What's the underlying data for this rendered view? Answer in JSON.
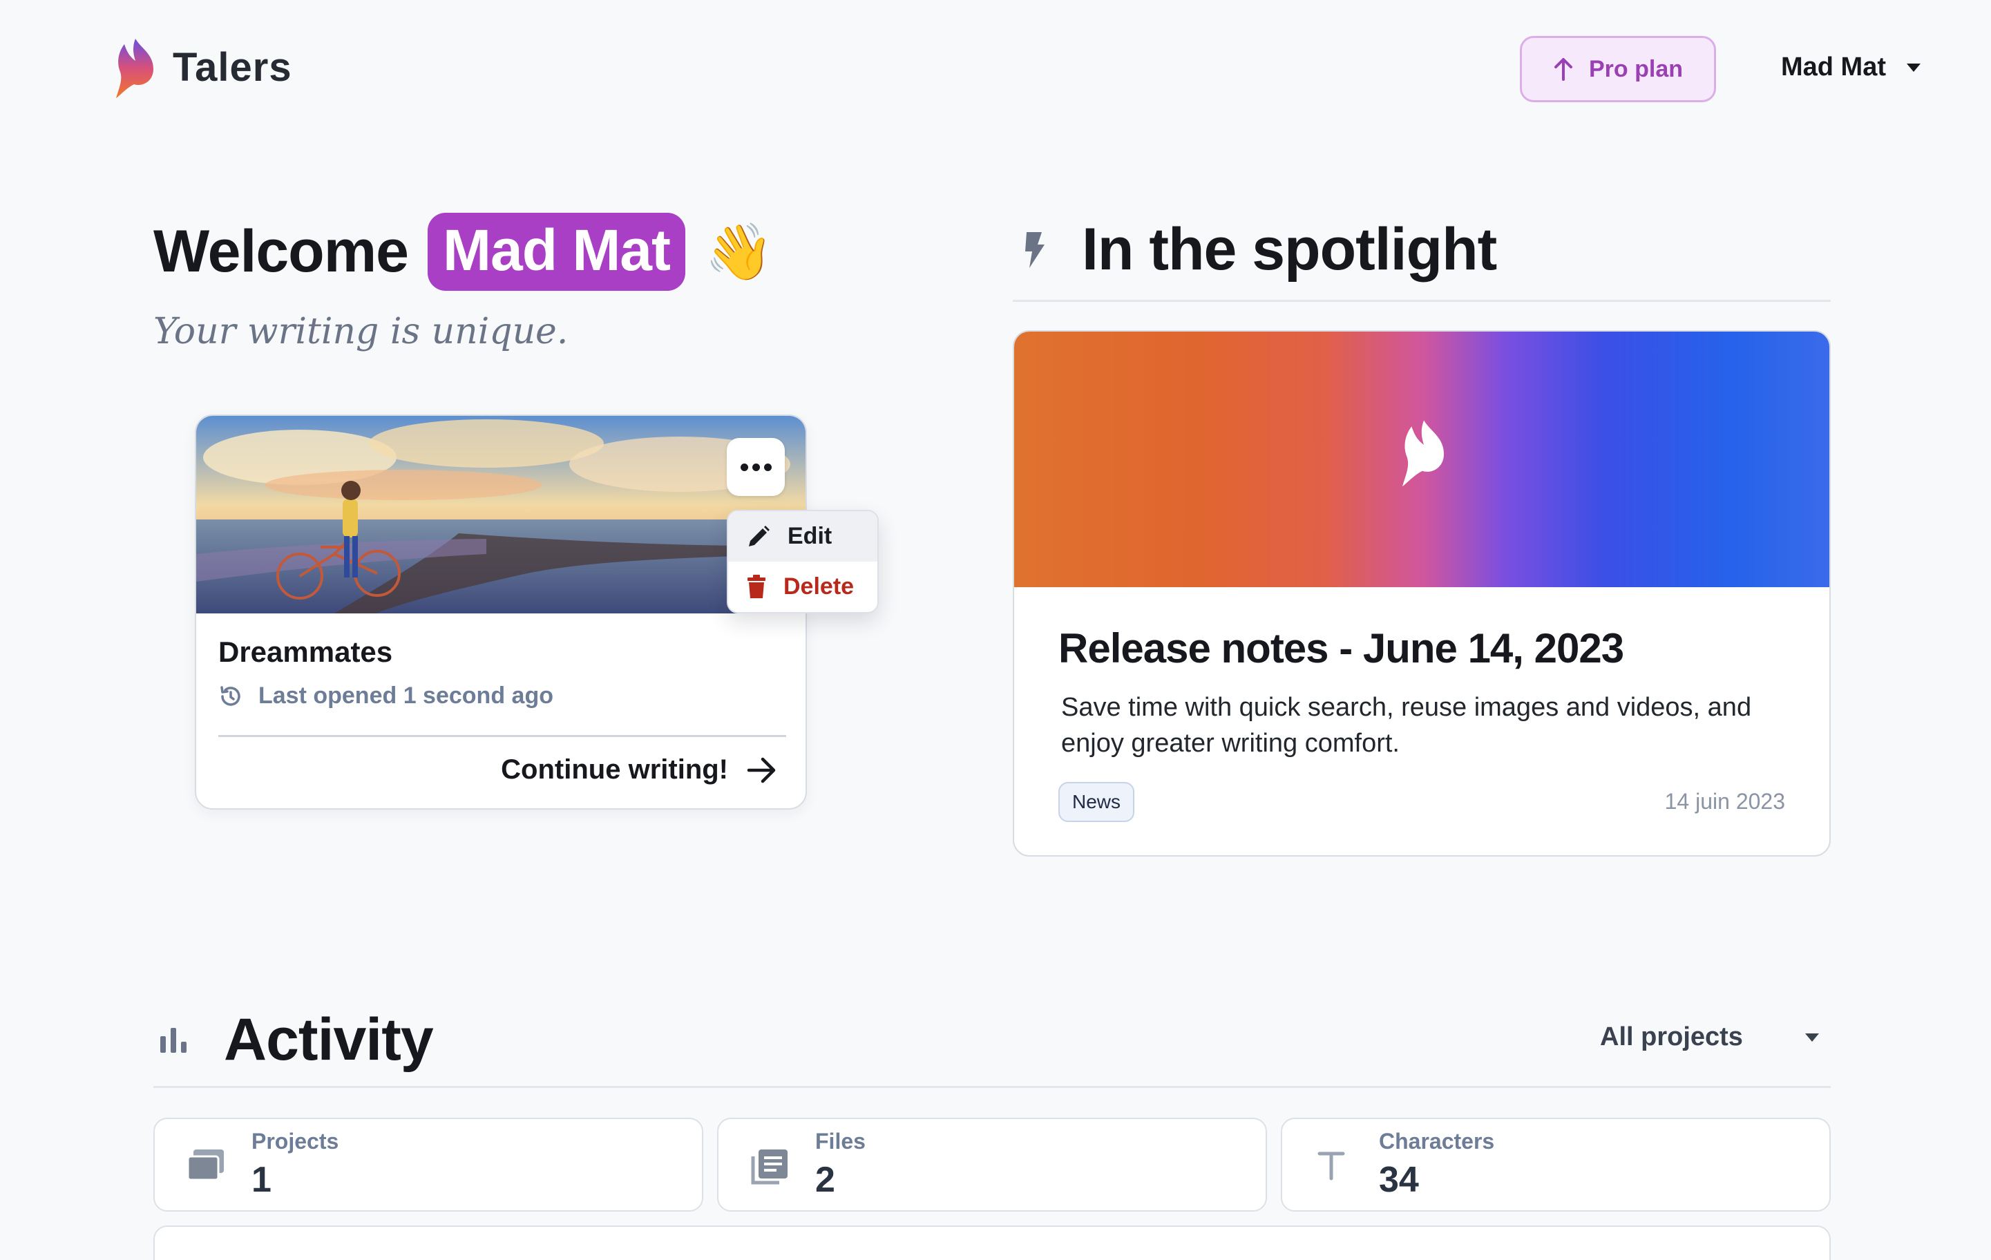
{
  "header": {
    "brand": "Talers",
    "pro_button": "Pro plan",
    "user_name": "Mad Mat"
  },
  "welcome": {
    "greeting": "Welcome",
    "name": "Mad Mat",
    "emoji": "👋",
    "tagline": "Your writing is unique."
  },
  "project_card": {
    "title": "Dreammates",
    "last_opened": "Last opened 1 second ago",
    "continue_label": "Continue writing!",
    "menu": {
      "edit": "Edit",
      "delete": "Delete"
    }
  },
  "spotlight": {
    "heading": "In the spotlight",
    "article": {
      "title": "Release notes - June 14, 2023",
      "description": "Save time with quick search, reuse images and videos, and enjoy greater writing comfort.",
      "tag": "News",
      "date": "14 juin 2023"
    }
  },
  "activity": {
    "heading": "Activity",
    "filter": "All projects",
    "stats": [
      {
        "label": "Projects",
        "value": "1",
        "icon": "projects-icon"
      },
      {
        "label": "Files",
        "value": "2",
        "icon": "files-icon"
      },
      {
        "label": "Characters",
        "value": "34",
        "icon": "characters-icon"
      }
    ]
  },
  "colors": {
    "accent": "#a93fc4",
    "danger": "#b8291c",
    "background": "#f8f9fb"
  }
}
